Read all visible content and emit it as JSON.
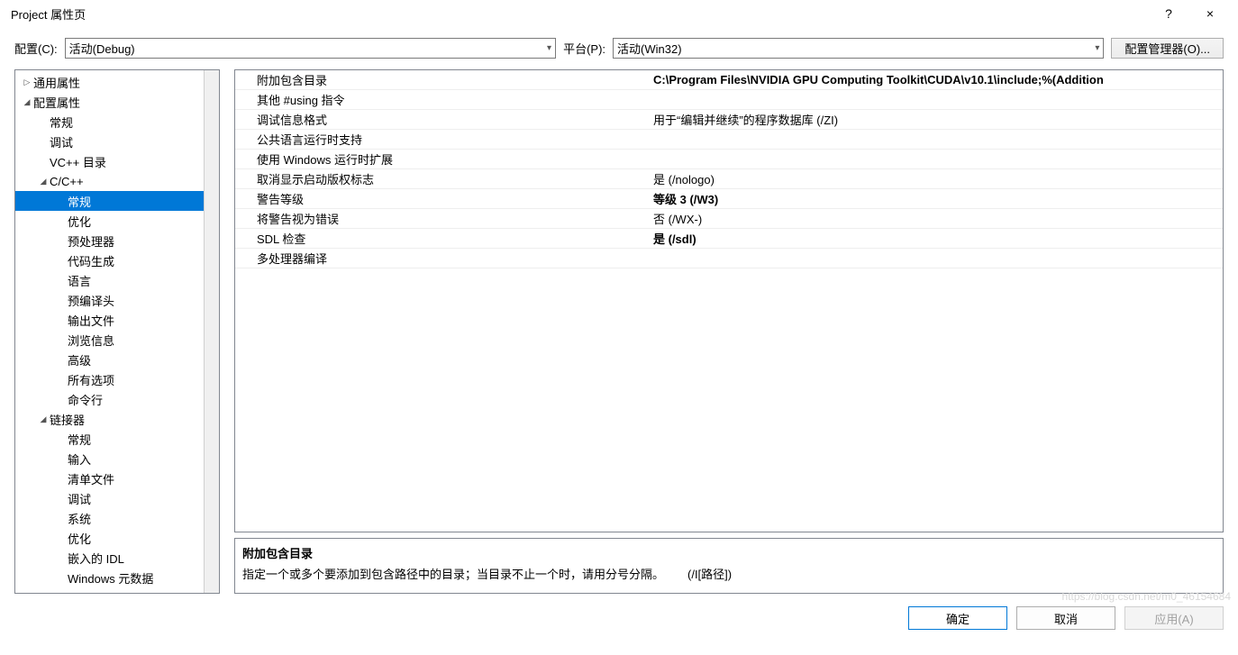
{
  "window": {
    "title": "Project 属性页",
    "help": "?",
    "close": "×"
  },
  "toolbar": {
    "config_label": "配置(C):",
    "config_value": "活动(Debug)",
    "platform_label": "平台(P):",
    "platform_value": "活动(Win32)",
    "config_manager": "配置管理器(O)..."
  },
  "tree": [
    {
      "lvl": 1,
      "tw": "▷",
      "label": "通用属性"
    },
    {
      "lvl": 1,
      "tw": "◢",
      "label": "配置属性"
    },
    {
      "lvl": 2,
      "tw": "",
      "label": "常规"
    },
    {
      "lvl": 2,
      "tw": "",
      "label": "调试"
    },
    {
      "lvl": 2,
      "tw": "",
      "label": "VC++ 目录"
    },
    {
      "lvl": 2,
      "tw": "◢",
      "label": "C/C++"
    },
    {
      "lvl": 3,
      "tw": "",
      "label": "常规",
      "sel": true
    },
    {
      "lvl": 3,
      "tw": "",
      "label": "优化"
    },
    {
      "lvl": 3,
      "tw": "",
      "label": "预处理器"
    },
    {
      "lvl": 3,
      "tw": "",
      "label": "代码生成"
    },
    {
      "lvl": 3,
      "tw": "",
      "label": "语言"
    },
    {
      "lvl": 3,
      "tw": "",
      "label": "预编译头"
    },
    {
      "lvl": 3,
      "tw": "",
      "label": "输出文件"
    },
    {
      "lvl": 3,
      "tw": "",
      "label": "浏览信息"
    },
    {
      "lvl": 3,
      "tw": "",
      "label": "高级"
    },
    {
      "lvl": 3,
      "tw": "",
      "label": "所有选项"
    },
    {
      "lvl": 3,
      "tw": "",
      "label": "命令行"
    },
    {
      "lvl": 2,
      "tw": "◢",
      "label": "链接器"
    },
    {
      "lvl": 3,
      "tw": "",
      "label": "常规"
    },
    {
      "lvl": 3,
      "tw": "",
      "label": "输入"
    },
    {
      "lvl": 3,
      "tw": "",
      "label": "清单文件"
    },
    {
      "lvl": 3,
      "tw": "",
      "label": "调试"
    },
    {
      "lvl": 3,
      "tw": "",
      "label": "系统"
    },
    {
      "lvl": 3,
      "tw": "",
      "label": "优化"
    },
    {
      "lvl": 3,
      "tw": "",
      "label": "嵌入的 IDL"
    },
    {
      "lvl": 3,
      "tw": "",
      "label": "Windows 元数据"
    }
  ],
  "grid": [
    {
      "label": "附加包含目录",
      "value": "C:\\Program Files\\NVIDIA GPU Computing Toolkit\\CUDA\\v10.1\\include;%(Addition",
      "bold": true
    },
    {
      "label": "其他 #using 指令",
      "value": ""
    },
    {
      "label": "调试信息格式",
      "value": "用于“编辑并继续”的程序数据库 (/ZI)"
    },
    {
      "label": "公共语言运行时支持",
      "value": ""
    },
    {
      "label": "使用 Windows 运行时扩展",
      "value": ""
    },
    {
      "label": "取消显示启动版权标志",
      "value": "是 (/nologo)"
    },
    {
      "label": "警告等级",
      "value": "等级 3 (/W3)",
      "bold": true
    },
    {
      "label": "将警告视为错误",
      "value": "否 (/WX-)"
    },
    {
      "label": "SDL 检查",
      "value": "是 (/sdl)",
      "bold": true
    },
    {
      "label": "多处理器编译",
      "value": ""
    }
  ],
  "description": {
    "title": "附加包含目录",
    "body": "指定一个或多个要添加到包含路径中的目录；当目录不止一个时，请用分号分隔。  (/I[路径])"
  },
  "footer": {
    "ok": "确定",
    "cancel": "取消",
    "apply": "应用(A)"
  },
  "watermark": "https://blog.csdn.net/m0_46154684"
}
